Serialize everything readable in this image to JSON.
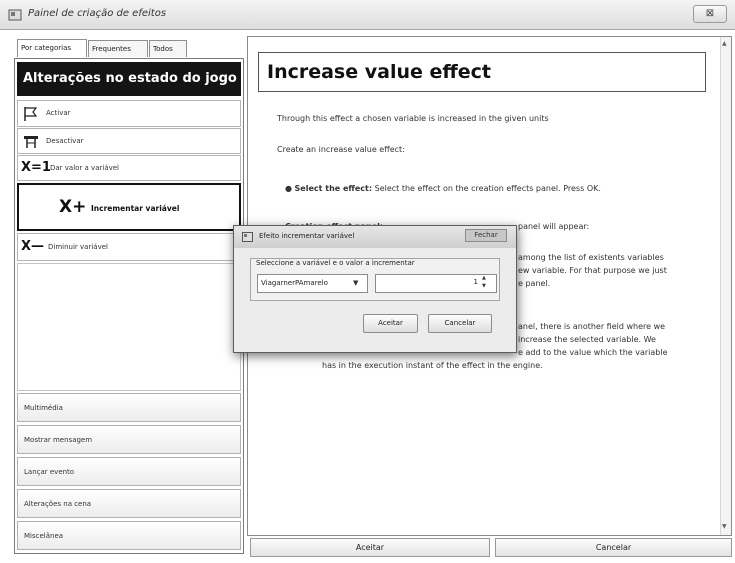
{
  "window": {
    "title": "Painel de criação de efeitos",
    "close": "⊠"
  },
  "tabs": [
    "Por categorias",
    "Frequentes",
    "Todos"
  ],
  "left": {
    "header": "Alterações no estado do jogo",
    "items": [
      {
        "label": "Activar",
        "icon": "flag-icon"
      },
      {
        "label": "Desactivar",
        "icon": "hanger-icon"
      },
      {
        "label": "Dar valor a variável",
        "icon": "assign-variable-icon",
        "glyph": "X=1"
      },
      {
        "label": "Incrementar variável",
        "icon": "increment-variable-icon",
        "glyph": "X+",
        "selected": true
      },
      {
        "label": "Diminuir variável",
        "icon": "decrement-variable-icon",
        "glyph": "X—"
      }
    ],
    "categories": [
      "Multimédia",
      "Mostrar mensagem",
      "Lançar evento",
      "Alterações na cena",
      "Miscelânea"
    ]
  },
  "help": {
    "title": "Increase value effect",
    "p1": "Through this effect a chosen variable is increased in the given units",
    "p2": "Create an increase value effect:",
    "b1_head": "Select the effect:",
    "b1_text": " Select the effect on the creation effects panel. Press OK.",
    "b2_head": "Creation effect panel:",
    "b2_tail": "panel will appear:",
    "frag1": "among the list of existents variables",
    "frag2": "ew variable. For that purpose we just",
    "frag3": "e panel.",
    "frag4": "anel, there is another field where we",
    "frag5": "increase the selected variable. We",
    "frag6": "e add to the value which the variable",
    "frag7": "has in the execution instant of the effect in the engine."
  },
  "bottom": {
    "accept": "Aceitar",
    "cancel": "Cancelar"
  },
  "dialog": {
    "title": "Efeito incrementar variável",
    "close": "Fechar",
    "group_label": "Seleccione a variável e o valor a incrementar",
    "selected_variable": "ViagarnerPAmarelo",
    "value": "1",
    "accept": "Aceitar",
    "cancel": "Cancelar"
  }
}
